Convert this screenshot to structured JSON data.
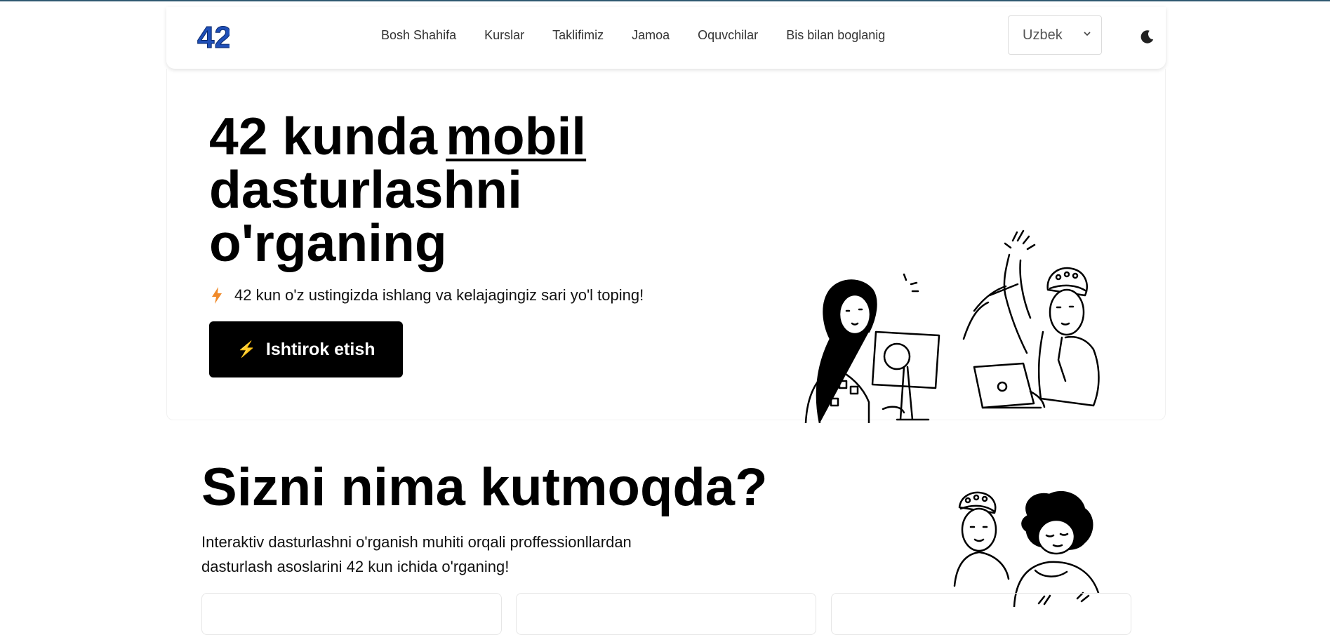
{
  "header": {
    "logo_text": "42",
    "nav": [
      {
        "label": "Bosh Shahifa"
      },
      {
        "label": "Kurslar"
      },
      {
        "label": "Taklifimiz"
      },
      {
        "label": "Jamoa"
      },
      {
        "label": "Oquvchilar"
      },
      {
        "label": "Bis bilan boglanig"
      }
    ],
    "language": {
      "selected": "Uzbek"
    },
    "theme_icon": "moon-icon"
  },
  "hero": {
    "title_part1": "42 kunda",
    "title_highlight": "mobil",
    "title_part2": "dasturlashni o'rganing",
    "subtitle": "42 kun o'z ustingizda ishlang va kelajagingiz sari yo'l toping!",
    "subtitle_icon": "bolt-icon",
    "cta_label": "Ishtirok etish",
    "cta_icon": "⚡"
  },
  "section": {
    "title": "Sizni nima kutmoqda?",
    "text": "Interaktiv dasturlashni o'rganish muhiti orqali proffessionllardan dasturlash asoslarini 42 kun ichida o'rganing!"
  },
  "colors": {
    "accent_logo": "#1f4fb8",
    "cta_bg": "#000000",
    "bolt_orange": "#f08a2a",
    "top_line": "#2f5970"
  }
}
